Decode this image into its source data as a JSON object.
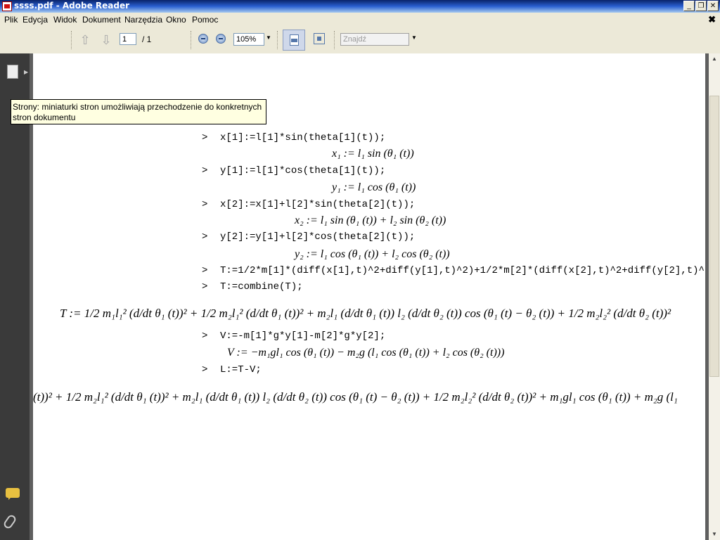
{
  "window": {
    "title": "ssss.pdf - Adobe Reader",
    "buttons": {
      "minimize": "_",
      "restore": "❐",
      "close": "✕"
    }
  },
  "menu": {
    "items": [
      "Plik",
      "Edycja",
      "Widok",
      "Dokument",
      "Narzędzia",
      "Okno",
      "Pomoc"
    ],
    "close_doc": "✖"
  },
  "toolbar": {
    "prev_page_icon": "arrow-up-icon",
    "next_page_icon": "arrow-down-icon",
    "page_current": "1",
    "page_total": "/ 1",
    "zoom": "105%",
    "search_placeholder": "Znajdź"
  },
  "tooltip": {
    "text": "Strony: miniaturki stron umożliwiają przechodzenie do konkretnych stron dokumentu"
  },
  "document": {
    "prompt": ">",
    "commands": [
      "x[1]:=l[1]*sin(theta[1](t));",
      "y[1]:=l[1]*cos(theta[1](t));",
      "x[2]:=x[1]+l[2]*sin(theta[2](t));",
      "y[2]:=y[1]+l[2]*cos(theta[2](t));",
      "T:=1/2*m[1]*(diff(x[1],t)^2+diff(y[1],t)^2)+1/2*m[2]*(diff(x[2],t)^2+diff(y[2],t)^",
      "T:=combine(T);",
      "V:=-m[1]*g*y[1]-m[2]*g*y[2];",
      "L:=T-V;"
    ],
    "outputs": [
      "x₁ := l₁ sin (θ₁ (t))",
      "y₁ := l₁ cos (θ₁ (t))",
      "x₂ := l₁ sin (θ₁ (t)) + l₂ sin (θ₂ (t))",
      "y₂ := l₁ cos (θ₁ (t)) + l₂ cos (θ₂ (t))",
      "T := 1/2 m₁l₁² (d/dt θ₁ (t))² + 1/2 m₂l₁² (d/dt θ₁ (t))² + m₂l₁ (d/dt θ₁ (t)) l₂ (d/dt θ₂ (t)) cos (θ₁ (t) − θ₂ (t)) + 1/2 m₂l₂² (d/dt θ₂ (t))²",
      "V := −m₁gl₁ cos (θ₁ (t)) − m₂g (l₁ cos (θ₁ (t)) + l₂ cos (θ₂ (t)))",
      "(t))² + 1/2 m₂l₁² (d/dt θ₁ (t))² + m₂l₁ (d/dt θ₁ (t)) l₂ (d/dt θ₂ (t)) cos (θ₁ (t) − θ₂ (t)) + 1/2 m₂l₂² (d/dt θ₂ (t))² + m₁gl₁ cos (θ₁ (t)) + m₂g (l₁"
    ]
  }
}
